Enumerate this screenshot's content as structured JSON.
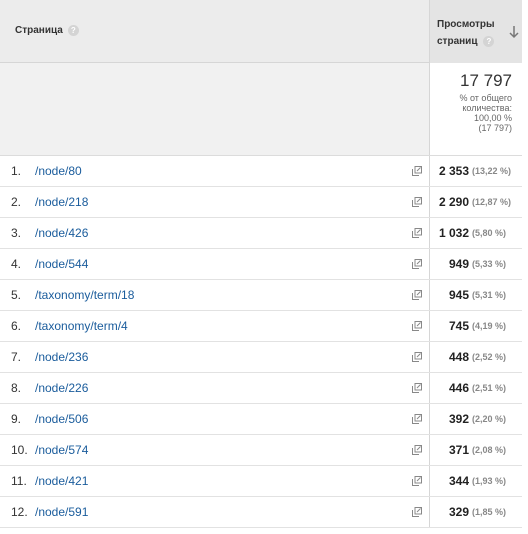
{
  "header": {
    "page_label": "Страница",
    "help_glyph": "?",
    "views_label_line1": "Просмотры",
    "views_label_line2": "страниц",
    "sort_icon": "arrow-down-icon"
  },
  "summary": {
    "total": "17 797",
    "line1": "% от общего",
    "line2": "количества:",
    "line3": "100,00 %",
    "line4": "(17 797)"
  },
  "rows": [
    {
      "index": "1.",
      "page": "/node/80",
      "views": "2 353",
      "percent": "(13,22 %)"
    },
    {
      "index": "2.",
      "page": "/node/218",
      "views": "2 290",
      "percent": "(12,87 %)"
    },
    {
      "index": "3.",
      "page": "/node/426",
      "views": "1 032",
      "percent": "(5,80 %)"
    },
    {
      "index": "4.",
      "page": "/node/544",
      "views": "949",
      "percent": "(5,33 %)"
    },
    {
      "index": "5.",
      "page": "/taxonomy/term/18",
      "views": "945",
      "percent": "(5,31 %)"
    },
    {
      "index": "6.",
      "page": "/taxonomy/term/4",
      "views": "745",
      "percent": "(4,19 %)"
    },
    {
      "index": "7.",
      "page": "/node/236",
      "views": "448",
      "percent": "(2,52 %)"
    },
    {
      "index": "8.",
      "page": "/node/226",
      "views": "446",
      "percent": "(2,51 %)"
    },
    {
      "index": "9.",
      "page": "/node/506",
      "views": "392",
      "percent": "(2,20 %)"
    },
    {
      "index": "10.",
      "page": "/node/574",
      "views": "371",
      "percent": "(2,08 %)"
    },
    {
      "index": "11.",
      "page": "/node/421",
      "views": "344",
      "percent": "(1,93 %)"
    },
    {
      "index": "12.",
      "page": "/node/591",
      "views": "329",
      "percent": "(1,85 %)"
    }
  ],
  "colors": {
    "link": "#1a5c9c",
    "header_bg": "#ececec",
    "summary_bg": "#f1f1f1"
  }
}
